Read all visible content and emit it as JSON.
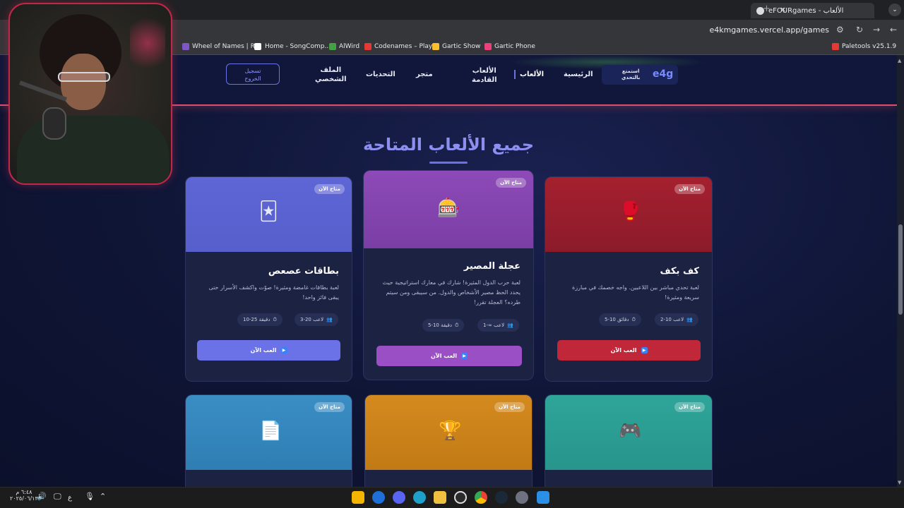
{
  "browser": {
    "tab_title": "الألعاب - eFOURgames",
    "url": "e4kmgames.vercel.app/games",
    "new_tab_icon": "+",
    "close_icon": "×",
    "menu_icon": "⌄",
    "bookmarks": [
      {
        "label": "Wheel of Names | R...",
        "color": "#7e57c2"
      },
      {
        "label": "Home - SongComp...",
        "color": "#ffffff"
      },
      {
        "label": "AlWird",
        "color": "#43a047"
      },
      {
        "label": "Codenames – Play...",
        "color": "#e53935"
      },
      {
        "label": "Gartic Show",
        "color": "#fbc02d"
      },
      {
        "label": "Gartic Phone",
        "color": "#ec407a"
      },
      {
        "label": "Paletools v25.1.9",
        "color": "#e53935"
      }
    ]
  },
  "nav": {
    "brand_logo": "e4g",
    "brand_tagline_1": "استمتع",
    "brand_tagline_2": "بالتحدي",
    "home": "الرئيسية",
    "games": "الألعاب",
    "upcoming_1": "الألعاب",
    "upcoming_2": "القادمة",
    "store": "متجر",
    "challenges": "التحديات",
    "profile_1": "الملف",
    "profile_2": "الشخصي",
    "logout_1": "تسجيل",
    "logout_2": "الخروج"
  },
  "section": {
    "title": "جميع الألعاب المتاحة"
  },
  "cards": [
    {
      "title": "كف بكف",
      "badge": "متاح الآن",
      "desc_1": "لعبة تحدي مباشر بين اللاعبين. واجه خصمك في مبارزة",
      "desc_2": "سريعة ومثيرة!",
      "players": "2-10 لاعب",
      "duration": "5-10 دقائق",
      "button": "العب الآن",
      "icon": "🥊",
      "accent": "#c0283a"
    },
    {
      "title": "عجلة المصير",
      "badge": "متاح الآن",
      "desc_1": "لعبة حرب الدول المثيرة! شارك في معارك استراتيجية حيث",
      "desc_2": "يحدد الحظ مصير الأشخاص والدول. من سيبقى ومن سيتم",
      "desc_3": "طرده؟ العجلة تقرر!",
      "players": "1-∞ لاعب",
      "duration": "5-10 دقيقة",
      "button": "العب الآن",
      "icon": "🎰",
      "accent": "#9b4fc4"
    },
    {
      "title": "بطاقات عصعص",
      "badge": "متاح الآن",
      "desc_1": "لعبة بطاقات غامضة ومثيرة! صوّت واكشف الأسرار حتى",
      "desc_2": "يبقى فائز واحد!",
      "players": "3-20 لاعب",
      "duration": "10-25 دقيقة",
      "button": "العب الآن",
      "icon": "🃏",
      "accent": "#6b72e8"
    },
    {
      "badge": "متاح الآن",
      "icon": "📄",
      "accent": "#3a8ec4"
    },
    {
      "badge": "متاح الآن",
      "icon": "🏆",
      "accent": "#d48a1e"
    },
    {
      "badge": "متاح الآن",
      "icon": "🎮",
      "accent": "#2fa59a"
    }
  ],
  "taskbar": {
    "time": "٦:٤٨ م",
    "date": "٢٠٢٥/٠٦/١٣",
    "lang": "ع"
  }
}
